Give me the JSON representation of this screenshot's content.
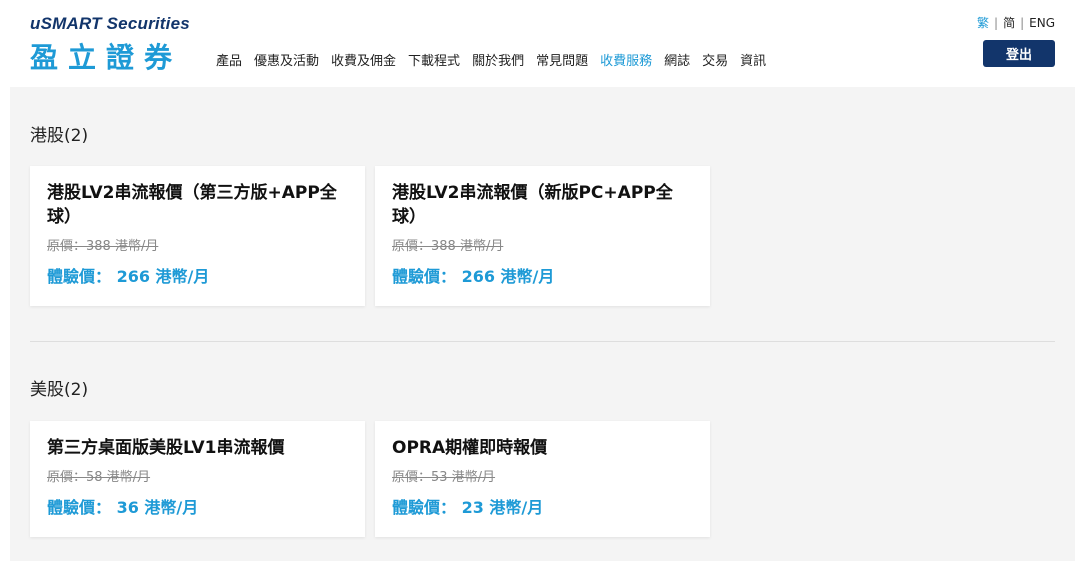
{
  "brand": {
    "name_en": "uSMART Securities",
    "name_cn": "盈立證券"
  },
  "nav": [
    {
      "label": "產品"
    },
    {
      "label": "優惠及活動"
    },
    {
      "label": "收費及佣金"
    },
    {
      "label": "下載程式"
    },
    {
      "label": "關於我們"
    },
    {
      "label": "常見問題"
    },
    {
      "label": "收費服務",
      "active": true
    },
    {
      "label": "網誌"
    },
    {
      "label": "交易"
    },
    {
      "label": "資訊"
    }
  ],
  "lang": {
    "trad": "繁",
    "simp": "简",
    "eng": "ENG",
    "sep": "|"
  },
  "login_label": "登出",
  "sections": [
    {
      "title": "港股(2)",
      "cards": [
        {
          "title": "港股LV2串流報價（第三方版+APP全球）",
          "original": "原價：388 港幣/月",
          "price": "體驗價： 266 港幣/月"
        },
        {
          "title": "港股LV2串流報價（新版PC+APP全球）",
          "original": "原價：388 港幣/月",
          "price": "體驗價： 266 港幣/月"
        }
      ]
    },
    {
      "title": "美股(2)",
      "cards": [
        {
          "title": "第三方桌面版美股LV1串流報價",
          "original": "原價：58 港幣/月",
          "price": "體驗價： 36 港幣/月"
        },
        {
          "title": "OPRA期權即時報價",
          "original": "原價：53 港幣/月",
          "price": "體驗價： 23 港幣/月"
        }
      ]
    }
  ],
  "colors": {
    "accent": "#1e9ad6",
    "brand_dark": "#12356b",
    "content_bg": "#f4f4f4"
  }
}
